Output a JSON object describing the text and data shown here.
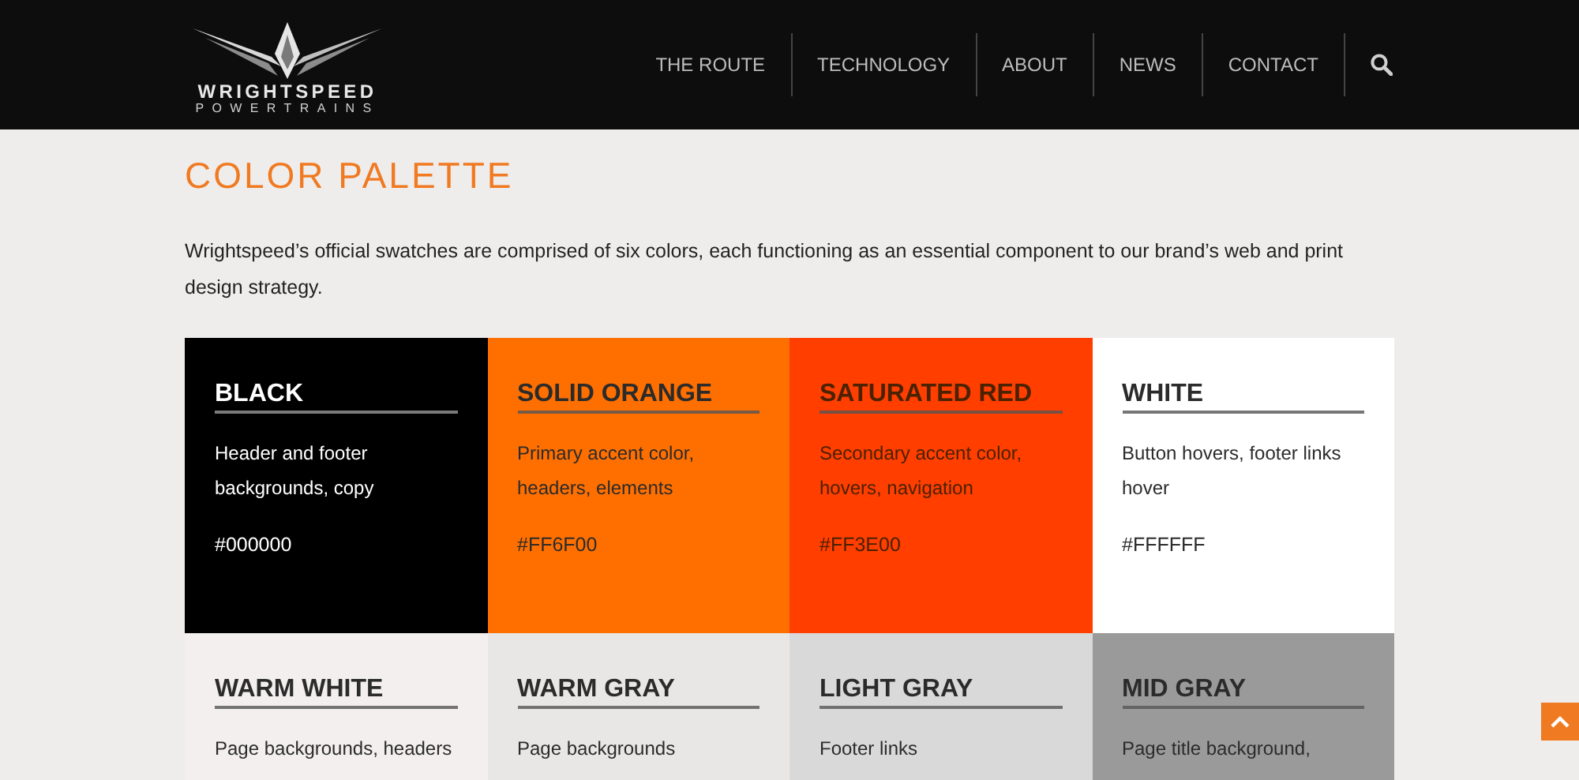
{
  "header": {
    "logo": {
      "name": "WRIGHTSPEED",
      "tagline": "POWERTRAINS"
    },
    "nav": [
      {
        "label": "THE ROUTE"
      },
      {
        "label": "TECHNOLOGY"
      },
      {
        "label": "ABOUT"
      },
      {
        "label": "NEWS"
      },
      {
        "label": "CONTACT"
      }
    ]
  },
  "page": {
    "title": "COLOR PALETTE",
    "intro": "Wrightspeed’s official swatches are comprised of six colors, each functioning as an essential component to our brand’s web and print design strategy."
  },
  "swatches": [
    {
      "name": "BLACK",
      "description": "Header and footer backgrounds, copy",
      "hex": "#000000",
      "color": "#000000"
    },
    {
      "name": "SOLID ORANGE",
      "description": "Primary accent color, headers, elements",
      "hex": "#FF6F00",
      "color": "#ff6f00"
    },
    {
      "name": "SATURATED RED",
      "description": "Secondary accent color, hovers, navigation",
      "hex": "#FF3E00",
      "color": "#ff3e00"
    },
    {
      "name": "WHITE",
      "description": "Button hovers, footer links hover",
      "hex": "#FFFFFF",
      "color": "#ffffff"
    },
    {
      "name": "WARM WHITE",
      "description": "Page backgrounds, headers",
      "color": "#f2efee"
    },
    {
      "name": "WARM GRAY",
      "description": "Page backgrounds",
      "color": "#e8e7e5"
    },
    {
      "name": "LIGHT GRAY",
      "description": "Footer links",
      "color": "#d9d9d9"
    },
    {
      "name": "MID GRAY",
      "description": "Page title background,",
      "color": "#9a9a9a"
    }
  ]
}
